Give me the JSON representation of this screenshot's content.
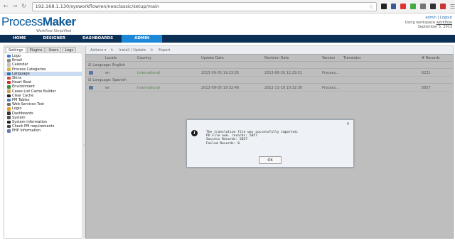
{
  "browser": {
    "url": "192.168.1.130/sysworkflow/en/neoclassic/setup/main"
  },
  "header": {
    "logo_main": "Process",
    "logo_bold": "Maker",
    "logo_sub": "Workflow Simplified",
    "user_link": "admin",
    "separator": " | ",
    "logout_link": "Logout",
    "workspace_prefix": "Using workspace ",
    "workspace_name": "workflow",
    "date": "September 5, 2013"
  },
  "nav": {
    "tabs": [
      {
        "label": "HOME"
      },
      {
        "label": "DESIGNER"
      },
      {
        "label": "DASHBOARDS"
      },
      {
        "label": "ADMIN"
      }
    ]
  },
  "sidebar": {
    "tabs": [
      {
        "label": "Settings"
      },
      {
        "label": "Plugins"
      },
      {
        "label": "Users"
      },
      {
        "label": "Logs"
      }
    ],
    "items": [
      {
        "label": "Logo",
        "color": "#3a7bd5"
      },
      {
        "label": "Email",
        "color": "#888888"
      },
      {
        "label": "Calendar",
        "color": "#c0c0c0"
      },
      {
        "label": "Process Categories",
        "color": "#d9b24c"
      },
      {
        "label": "Language",
        "color": "#2f6fb7"
      },
      {
        "label": "Skins",
        "color": "#d24a2a"
      },
      {
        "label": "Heart Beat",
        "color": "#d12b2b"
      },
      {
        "label": "Environment",
        "color": "#3d8b3d"
      },
      {
        "label": "Cases List Cache Builder",
        "color": "#c9a15a"
      },
      {
        "label": "Clear Cache",
        "color": "#222222"
      },
      {
        "label": "PM Tables",
        "color": "#4a7bc4"
      },
      {
        "label": "Web Services Test",
        "color": "#6a6a6a"
      },
      {
        "label": "Login",
        "color": "#e0a020"
      },
      {
        "label": "Dashboards",
        "color": "#333333"
      },
      {
        "label": "System",
        "color": "#555555"
      },
      {
        "label": "System information",
        "color": "#222222"
      },
      {
        "label": "Check PM requirements",
        "color": "#444444"
      },
      {
        "label": "PHP Information",
        "color": "#6a7ab0"
      }
    ]
  },
  "toolbar": {
    "actions_label": "Actions ▾",
    "install_label": "Install / Update",
    "export_label": "Export"
  },
  "table": {
    "columns": {
      "locale": "Locale",
      "country": "Country",
      "update_date": "Update Date",
      "revision_date": "Revision Date",
      "version": "Version",
      "translator": "Translator",
      "records": "# Records"
    },
    "groups": [
      {
        "label": "Language: English",
        "row": {
          "locale": "en",
          "country": "International",
          "update_date": "2013-09-05 19:23:35",
          "revision_date": "2013-06-26 12:29:51",
          "version": "Process...",
          "records": "6231"
        }
      },
      {
        "label": "Language: Spanish",
        "row": {
          "locale": "es",
          "country": "International",
          "update_date": "2013-09-05 19:32:48",
          "revision_date": "2012-11-16 10:32:36",
          "version": "Process...",
          "records": "5857"
        }
      }
    ]
  },
  "dialog": {
    "message": "The translation file was successfully imported.\nPO File num. records: 5857\nSuccess Records: 5857\nFailed Records: 0",
    "ok_label": "OK",
    "close_glyph": "×",
    "info_glyph": "i"
  }
}
